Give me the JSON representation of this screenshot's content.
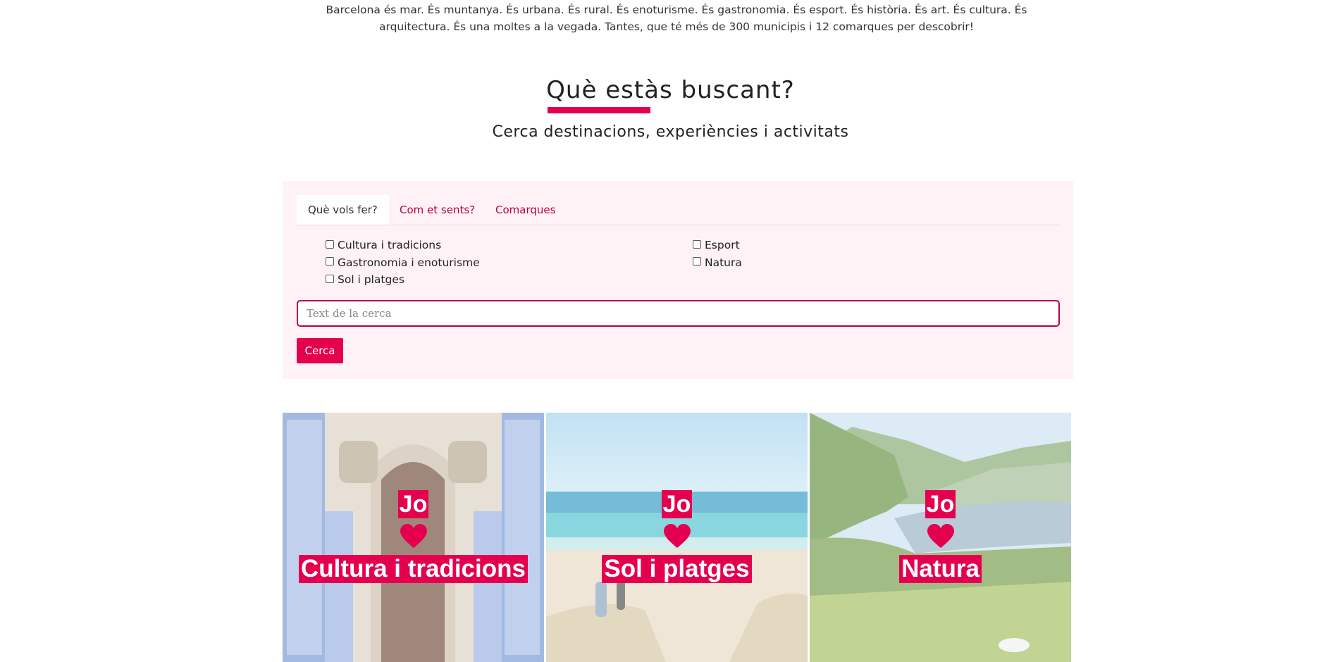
{
  "intro_text": "Barcelona és mar. És muntanya. És urbana. És rural. És enoturisme. És gastronomia. És esport. És història. És art. És cultura. És arquitectura. És una moltes a la vegada. Tantes, que té més de 300 municipis i 12 comarques per descobrir!",
  "heading": "Què estàs buscant?",
  "subheading": "Cerca destinacions, experiències i activitats",
  "tabs": [
    {
      "label": "Què vols fer?",
      "active": true
    },
    {
      "label": "Com et sents?",
      "active": false
    },
    {
      "label": "Comarques",
      "active": false
    }
  ],
  "filters": {
    "left": [
      {
        "label": "Cultura i tradicions",
        "checked": false
      },
      {
        "label": "Gastronomia i enoturisme",
        "checked": false
      },
      {
        "label": "Sol i platges",
        "checked": false
      }
    ],
    "right": [
      {
        "label": "Esport",
        "checked": false
      },
      {
        "label": "Natura",
        "checked": false
      }
    ]
  },
  "search": {
    "placeholder": "Text de la cerca",
    "value": "",
    "button_label": "Cerca"
  },
  "cards": [
    {
      "jo": "Jo",
      "heart_icon": "heart-icon",
      "topic": "Cultura i tradicions"
    },
    {
      "jo": "Jo",
      "heart_icon": "heart-icon",
      "topic": "Sol i platges"
    },
    {
      "jo": "Jo",
      "heart_icon": "heart-icon",
      "topic": "Natura"
    }
  ],
  "colors": {
    "accent": "#e5004f",
    "tab_text": "#b8004a",
    "panel_bg": "#fff2f6"
  }
}
